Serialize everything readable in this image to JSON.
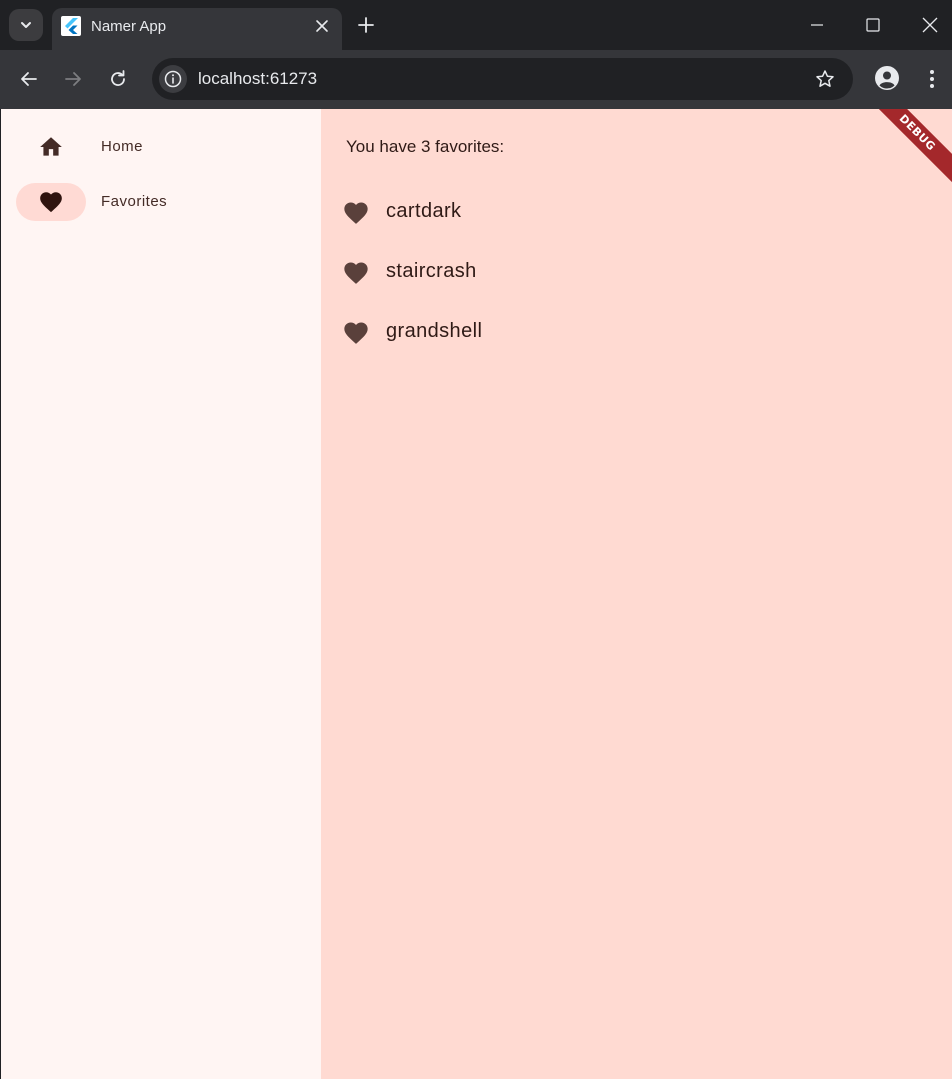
{
  "browser": {
    "tab_title": "Namer App",
    "url": "localhost:61273"
  },
  "nav": {
    "destinations": [
      {
        "label": "Home",
        "icon": "home-icon",
        "selected": false
      },
      {
        "label": "Favorites",
        "icon": "favorite-icon",
        "selected": true
      }
    ]
  },
  "favorites": {
    "count_text": "You have 3 favorites:",
    "items": [
      "cartdark",
      "staircrash",
      "grandshell"
    ]
  },
  "debug_banner": "DEBUG",
  "colors": {
    "rail_bg": "#fff5f3",
    "content_bg": "#ffdad2",
    "indicator": "#ffdad4",
    "heart": "#5a403b",
    "banner": "#a4282b"
  }
}
